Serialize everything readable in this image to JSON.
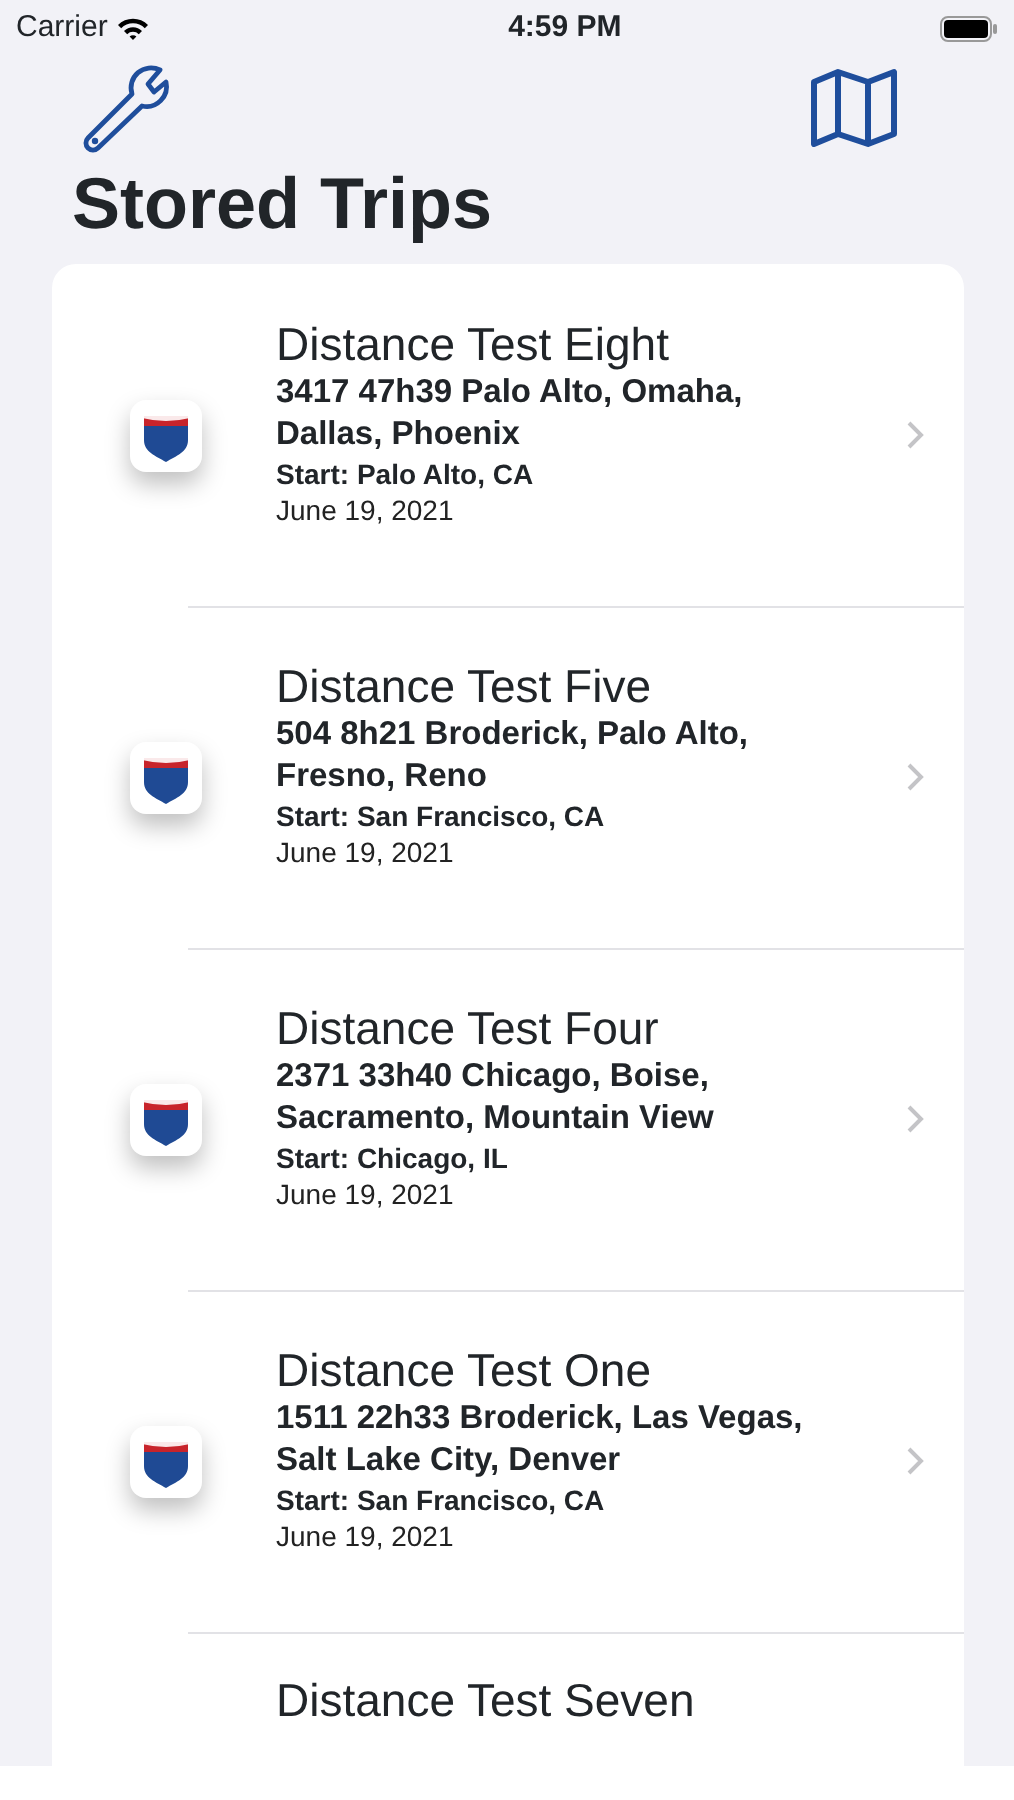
{
  "status_bar": {
    "carrier": "Carrier",
    "time": "4:59 PM"
  },
  "title": "Stored Trips",
  "trips": [
    {
      "name": "Distance Test Eight",
      "summary": "3417 47h39 Palo Alto, Omaha, Dallas, Phoenix",
      "start": "Start: Palo Alto, CA",
      "date": "June 19, 2021"
    },
    {
      "name": "Distance Test Five",
      "summary": "504 8h21 Broderick, Palo Alto, Fresno, Reno",
      "start": "Start: San Francisco, CA",
      "date": "June 19, 2021"
    },
    {
      "name": "Distance Test Four",
      "summary": "2371 33h40 Chicago, Boise, Sacramento, Mountain View",
      "start": "Start: Chicago, IL",
      "date": "June 19, 2021"
    },
    {
      "name": "Distance Test One",
      "summary": "1511 22h33 Broderick, Las Vegas, Salt Lake City, Denver",
      "start": "Start: San Francisco, CA",
      "date": "June 19, 2021"
    },
    {
      "name": "Distance Test Seven"
    }
  ]
}
